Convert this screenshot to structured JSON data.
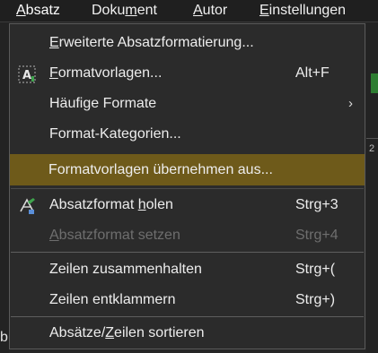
{
  "menubar": {
    "items": [
      {
        "label": "Absatz",
        "mnemonic": "A"
      },
      {
        "label": "Dokument",
        "mnemonic": "m"
      },
      {
        "label": "Autor",
        "mnemonic": "A"
      },
      {
        "label": "Einstellungen",
        "mnemonic": "E"
      }
    ]
  },
  "menu": {
    "items": [
      {
        "label": "Erweiterte Absatzformatierung...",
        "shortcut": "",
        "icon": "",
        "enabled": true
      },
      {
        "label": "Formatvorlagen...",
        "shortcut": "Alt+F",
        "icon": "style-icon",
        "enabled": true
      },
      {
        "label": "Häufige Formate",
        "shortcut": "",
        "submenu": "›",
        "enabled": true
      },
      {
        "label": "Format-Kategorien...",
        "shortcut": "",
        "enabled": true
      },
      {
        "label": "Formatvorlagen übernehmen aus...",
        "shortcut": "",
        "enabled": true,
        "highlighted": true
      },
      {
        "label": "Absatzformat holen",
        "shortcut": "Strg+3",
        "icon": "format-painter-icon",
        "enabled": true
      },
      {
        "label": "Absatzformat setzen",
        "shortcut": "Strg+4",
        "enabled": false
      },
      {
        "label": "Zeilen zusammenhalten",
        "shortcut": "Strg+(",
        "enabled": true
      },
      {
        "label": "Zeilen entklammern",
        "shortcut": "Strg+)",
        "enabled": true
      },
      {
        "label": "Absätze/Zeilen sortieren",
        "shortcut": "",
        "enabled": true
      }
    ]
  },
  "background": {
    "ruler_text": "2",
    "stray_letter": "b"
  },
  "colors": {
    "highlight": "#6e5a1a",
    "menu_bg": "#2b2b2b",
    "disabled_text": "#6e6e6e",
    "accent_green": "#2e7d32"
  }
}
